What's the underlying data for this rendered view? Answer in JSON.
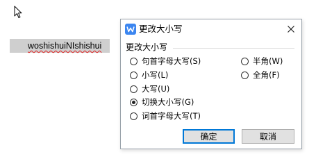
{
  "document": {
    "text": "woshishuiNIshishui"
  },
  "dialog": {
    "title": "更改大小写",
    "group_label": "更改大小写",
    "options_left": [
      {
        "label": "句首字母大写(S)",
        "checked": false
      },
      {
        "label": "小写(L)",
        "checked": false
      },
      {
        "label": "大写(U)",
        "checked": false
      },
      {
        "label": "切换大小写(G)",
        "checked": true
      },
      {
        "label": "词首字母大写(T)",
        "checked": false
      }
    ],
    "options_right": [
      {
        "label": "半角(W)",
        "checked": false
      },
      {
        "label": "全角(F)",
        "checked": false
      }
    ],
    "ok_label": "确定",
    "cancel_label": "取消"
  },
  "colors": {
    "accent": "#0078d7",
    "app_icon": "#3c86f0",
    "selection": "#cfcfcf"
  }
}
